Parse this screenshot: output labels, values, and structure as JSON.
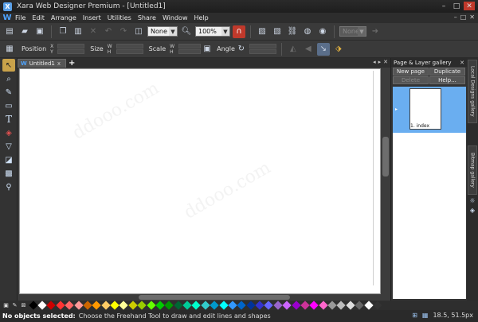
{
  "window": {
    "title": "Xara Web Designer Premium - [Untitled1]",
    "controls": [
      "–",
      "□",
      "✕"
    ]
  },
  "menu": {
    "logo": "W",
    "items": [
      "File",
      "Edit",
      "Arrange",
      "Insert",
      "Utilities",
      "Share",
      "Window",
      "Help"
    ],
    "doc_controls": [
      "–",
      "□",
      "✕"
    ]
  },
  "toolbar1": {
    "quality_select": "None",
    "zoom_select": "100%",
    "page_select": "None"
  },
  "toolbar2": {
    "position_label": "Position",
    "x_label": "X",
    "y_label": "Y",
    "size_label": "Size",
    "w_label": "W",
    "h_label": "H",
    "scale_label": "Scale",
    "scale_w_label": "W",
    "scale_h_label": "H",
    "angle_label": "Angle"
  },
  "doc_tab": {
    "label": "Untitled1",
    "close": "x",
    "add": "+"
  },
  "gallery": {
    "title": "Page & Layer gallery",
    "new_page": "New page",
    "duplicate": "Duplicate",
    "delete": "Delete",
    "help": "Help...",
    "page_label": "1. index"
  },
  "side_tabs": {
    "local_designs": "Local Designs gallery",
    "bitmap": "Bitmap gallery"
  },
  "palette": {
    "colors": [
      "#000000",
      "#ffffff",
      "#cc0000",
      "#ff3333",
      "#ff6666",
      "#ff9999",
      "#cc6600",
      "#ff9900",
      "#ffcc66",
      "#ffff00",
      "#ffff99",
      "#cccc00",
      "#99cc00",
      "#66ff00",
      "#00cc00",
      "#009900",
      "#006633",
      "#00cc99",
      "#00ffcc",
      "#33cccc",
      "#0099cc",
      "#00ffff",
      "#3399ff",
      "#0066cc",
      "#003399",
      "#3333cc",
      "#6666ff",
      "#9966cc",
      "#cc66ff",
      "#9900cc",
      "#cc3399",
      "#ff00ff",
      "#ff66cc",
      "#999999",
      "#bbbbbb",
      "#dddddd",
      "#666666",
      "#ffffff",
      "#333333"
    ]
  },
  "status": {
    "bold": "No objects selected:",
    "message": "Choose the Freehand Tool to draw and edit lines and shapes",
    "coords": "18.5, 51.5px"
  }
}
